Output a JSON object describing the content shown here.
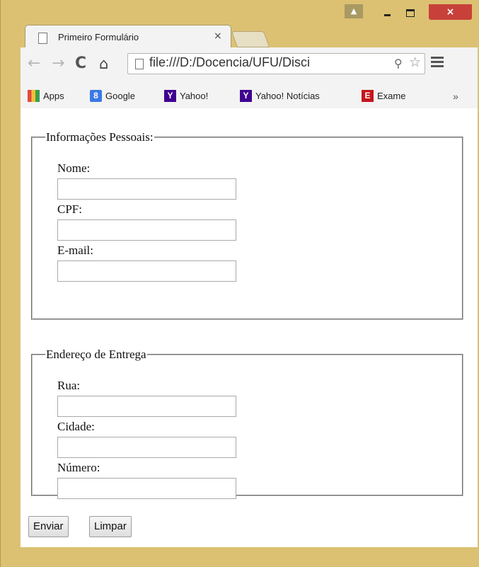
{
  "browser": {
    "tab_title": "Primeiro Formulário",
    "tab_close": "×",
    "url": "file:///D:/Docencia/UFU/Disci",
    "window_close": "×",
    "bookmarks": [
      {
        "label": "Apps",
        "icon": "apps-grid-icon"
      },
      {
        "label": "Google",
        "icon": "google-icon"
      },
      {
        "label": "Yahoo!",
        "icon": "yahoo-icon"
      },
      {
        "label": "Yahoo! Notícias",
        "icon": "yahoo-icon"
      },
      {
        "label": "Exame",
        "icon": "exame-icon"
      }
    ],
    "bookmarks_more": "»"
  },
  "form": {
    "personal": {
      "legend": "Informações Pessoais:",
      "fields": [
        {
          "label": "Nome:",
          "value": ""
        },
        {
          "label": "CPF:",
          "value": ""
        },
        {
          "label": "E-mail:",
          "value": ""
        }
      ]
    },
    "delivery": {
      "legend": "Endereço de Entrega",
      "fields": [
        {
          "label": "Rua:",
          "value": ""
        },
        {
          "label": "Cidade:",
          "value": ""
        },
        {
          "label": "Número:",
          "value": ""
        }
      ]
    },
    "submit_label": "Enviar",
    "reset_label": "Limpar"
  }
}
